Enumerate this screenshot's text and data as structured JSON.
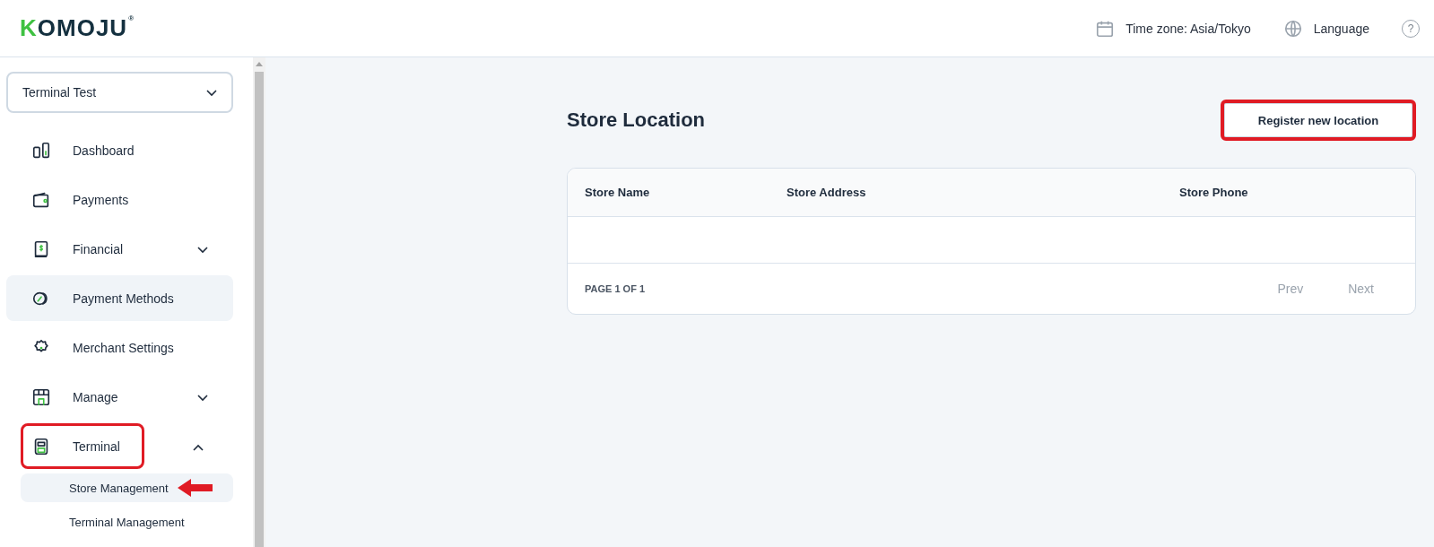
{
  "header": {
    "logo": {
      "text": "KOMOJU",
      "mark": "®"
    },
    "timezone": "Time zone: Asia/Tokyo",
    "language": "Language",
    "help": "?"
  },
  "sidebar": {
    "account": "Terminal Test",
    "items": [
      {
        "kind": "link",
        "label": "Dashboard",
        "selected": false
      },
      {
        "kind": "link",
        "label": "Payments",
        "selected": false
      },
      {
        "kind": "group",
        "label": "Financial",
        "selected": false,
        "expanded": false
      },
      {
        "kind": "link",
        "label": "Payment Methods",
        "selected": true
      },
      {
        "kind": "link",
        "label": "Merchant Settings",
        "selected": false
      },
      {
        "kind": "group",
        "label": "Manage",
        "selected": false,
        "expanded": false
      },
      {
        "kind": "group",
        "label": "Terminal",
        "selected": false,
        "expanded": true,
        "annotated": true,
        "children": [
          {
            "label": "Store Management",
            "selected": true,
            "pointed": true
          },
          {
            "label": "Terminal Management",
            "selected": false,
            "pointed": false
          }
        ]
      }
    ]
  },
  "main": {
    "title": "Store Location",
    "action": {
      "label": "Register new location",
      "annotated": true
    },
    "table": {
      "columns": [
        "Store Name",
        "Store Address",
        "Store Phone"
      ],
      "page": "PAGE 1 OF 1",
      "prev": "Prev",
      "next": "Next"
    }
  }
}
